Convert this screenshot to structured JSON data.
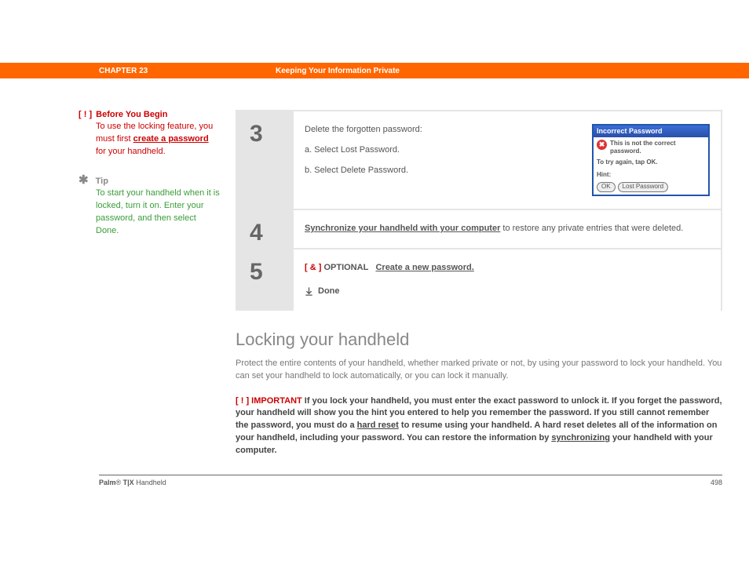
{
  "header": {
    "chapter": "CHAPTER 23",
    "title": "Keeping Your Information Private"
  },
  "sidebar": {
    "before": {
      "marker": "[ ! ]",
      "title": "Before You Begin",
      "body_pre": "To use the locking feature, you must first ",
      "link": "create a password",
      "body_post": " for your handheld."
    },
    "tip": {
      "marker": "✱",
      "title": "Tip",
      "body": "To start your handheld when it is locked, turn it on. Enter your password, and then select Done."
    }
  },
  "steps": {
    "s3": {
      "num": "3",
      "lead": "Delete the forgotten password:",
      "a": "a.  Select Lost Password.",
      "b": "b.  Select Delete Password."
    },
    "s4": {
      "num": "4",
      "link": "Synchronize your handheld with your computer",
      "rest": " to restore any private entries that were deleted."
    },
    "s5": {
      "num": "5",
      "marker": "[ & ]",
      "label": "OPTIONAL",
      "link": "Create a new password.",
      "done": "Done"
    }
  },
  "dialog": {
    "title": "Incorrect Password",
    "msg": "This is not the correct password.",
    "retry": "To try again, tap OK.",
    "hint": "Hint:",
    "ok": "OK",
    "lost": "Lost Password"
  },
  "section": {
    "title": "Locking your handheld",
    "body": "Protect the entire contents of your handheld, whether marked private or not, by using your password to lock your handheld. You can set your handheld to lock automatically, or you can lock it manually."
  },
  "important": {
    "marker": "[ ! ]",
    "label": "IMPORTANT",
    "t1": " If you lock your handheld, you must enter the exact password to unlock it. If you forget the password, your handheld will show you the hint you entered to help you remember the password. If you still cannot remember the password, you must do a ",
    "link1": "hard reset",
    "t2": " to resume using your handheld. A hard reset deletes all of the information on your handheld, including your password. You can restore the information by ",
    "link2": "synchronizing",
    "t3": " your handheld with your computer."
  },
  "footer": {
    "brand": "Palm",
    "reg": "®",
    "model": " T|X",
    "suffix": " Handheld",
    "page": "498"
  }
}
